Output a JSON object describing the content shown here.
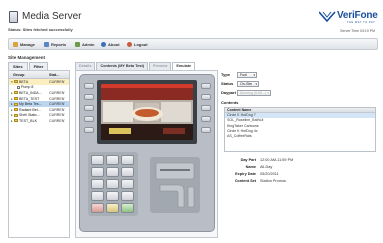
{
  "app": {
    "title": "Media Server",
    "status_label": "Status:",
    "status_text": "Sites fetched successfully",
    "brand": "VeriFone",
    "brand_tagline": "THE WAY TO PAY",
    "server_time": "Server Time 03:19 PM"
  },
  "toolbar": {
    "items": [
      {
        "label": "Manage",
        "icon": "manage-icon",
        "color": "#d9a43a"
      },
      {
        "label": "Reports",
        "icon": "reports-icon",
        "color": "#5a86c2"
      },
      {
        "label": "Admin",
        "icon": "admin-icon",
        "color": "#6d9b4a"
      },
      {
        "label": "About",
        "icon": "about-icon",
        "color": "#3d6fb6"
      },
      {
        "label": "Logout",
        "icon": "logout-icon",
        "color": "#c65b3b"
      }
    ]
  },
  "site_management": {
    "title": "Site Management",
    "tabs": [
      "Sites",
      "Filter"
    ],
    "columns": [
      "Group",
      "Stat..."
    ],
    "rows": [
      {
        "name": "BETA",
        "status": "CURRENT",
        "type": "folder"
      },
      {
        "name": "Pump 8",
        "status": "",
        "type": "item"
      },
      {
        "name": "BETA_INDA...",
        "status": "CURRENT",
        "type": "folder"
      },
      {
        "name": "BETA_TEST",
        "status": "CURRENT",
        "type": "folder"
      },
      {
        "name": "My Beta Tes...",
        "status": "CURRENT",
        "type": "folder",
        "state": "highlighted"
      },
      {
        "name": "Radiant Bet...",
        "status": "CURRENT",
        "type": "folder"
      },
      {
        "name": "Shell Static...",
        "status": "CURRENT",
        "type": "folder"
      },
      {
        "name": "TEST_BLK",
        "status": "CURRENT",
        "type": "folder"
      }
    ]
  },
  "middle": {
    "tabs": [
      {
        "label": "Details",
        "state": "disabled"
      },
      {
        "label": "Contents (MY Beta Test)",
        "state": "normal"
      },
      {
        "label": "Preview",
        "state": "disabled"
      },
      {
        "label": "Emulate",
        "state": "active"
      }
    ]
  },
  "emulate": {
    "type_label": "Type",
    "type_value": "Fuel",
    "status_label": "Status",
    "status_value": "On-Site",
    "daypart_label": "Daypart",
    "daypart_value": "Morning (6:00...)",
    "contents_label": "Contents",
    "contents_header": "Content Name",
    "contents": [
      {
        "name": "Circle K HotDog 7",
        "selected": true
      },
      {
        "name": "SOL_Roseline_BathLit",
        "selected": false
      },
      {
        "name": "KingTaker Cartoons",
        "selected": false
      },
      {
        "name": "Circle K HotDog 4c",
        "selected": false
      },
      {
        "name": "AS_CoffeeRats",
        "selected": false
      }
    ],
    "details": [
      {
        "key": "Day Part",
        "value": "12:00 AM-11:59 PM"
      },
      {
        "key": "Name",
        "value": "All-Day"
      },
      {
        "key": "Expiry Date",
        "value": "05/20/2011"
      },
      {
        "key": "Content Set",
        "value": "Station Promos"
      }
    ]
  }
}
